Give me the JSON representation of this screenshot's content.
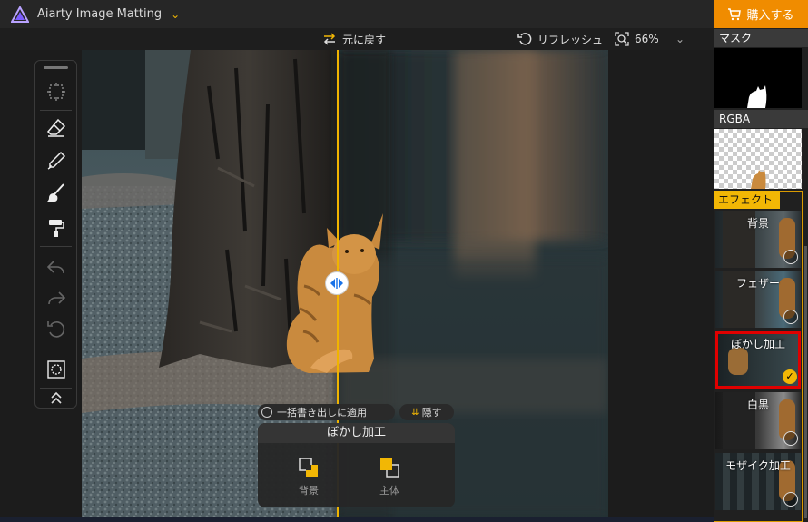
{
  "app": {
    "title": "Aiarty Image Matting",
    "buy_label": "購入する"
  },
  "toolbar": {
    "undo_label": "元に戻す",
    "refresh_label": "リフレッシュ",
    "zoom_label": "66%"
  },
  "right_panel": {
    "mask_label": "マスク",
    "rgba_label": "RGBA",
    "effect_tab": "エフェクト",
    "effects": [
      {
        "label": "背景",
        "selected": false
      },
      {
        "label": "フェザー",
        "selected": false
      },
      {
        "label": "ぼかし加工",
        "selected": true
      },
      {
        "label": "白黒",
        "selected": false
      },
      {
        "label": "モザイク加工",
        "selected": false
      }
    ]
  },
  "bottom_panel": {
    "apply_all_label": "一括書き出しに適用",
    "hide_label": "隠す",
    "title": "ぼかし加工",
    "option_background": "背景",
    "option_subject": "主体"
  },
  "colors": {
    "accent": "#f2b705",
    "buy": "#f08c00",
    "selected_outline": "#e00000"
  }
}
